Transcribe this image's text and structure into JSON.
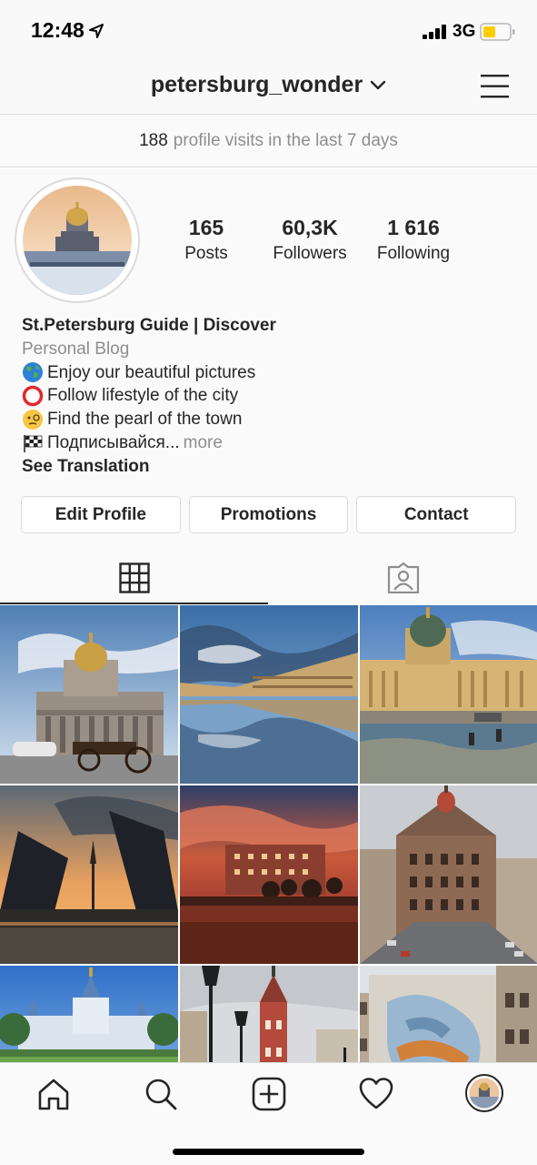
{
  "status_bar": {
    "time": "12:48",
    "network": "3G"
  },
  "header": {
    "username": "petersburg_wonder"
  },
  "visits_banner": {
    "count": "188",
    "text": "profile visits in the last 7 days"
  },
  "stats": [
    {
      "value": "165",
      "label": "Posts"
    },
    {
      "value": "60,3K",
      "label": "Followers"
    },
    {
      "value": "1 616",
      "label": "Following"
    }
  ],
  "bio": {
    "name": "St.Petersburg Guide | Discover",
    "category": "Personal Blog",
    "lines": [
      {
        "emoji": "globe-icon",
        "text": "Enjoy our beautiful pictures"
      },
      {
        "emoji": "red-circle-icon",
        "text": "Follow lifestyle of the city"
      },
      {
        "emoji": "monocle-face-icon",
        "text": "Find the pearl of the town"
      },
      {
        "emoji": "checkered-flag-icon",
        "text": "Подписывайся..."
      }
    ],
    "more": "more",
    "see_translation": "See Translation"
  },
  "actions": {
    "edit_profile": "Edit Profile",
    "promotions": "Promotions",
    "contact": "Contact"
  },
  "tabs": [
    "grid-icon",
    "tagged-icon"
  ],
  "posts": [
    "isaac-cathedral-carriage",
    "palace-square-reflection",
    "kazan-cathedral-canal",
    "palace-bridge-sunset",
    "sunset-embankment",
    "singer-house-street",
    "smolny-cathedral",
    "street-lamps-tower",
    "mural-building"
  ],
  "colors": {
    "accent": "#262626",
    "muted": "#8e8e8e",
    "border": "#dbdbdb",
    "battery": "#ffcc00"
  }
}
